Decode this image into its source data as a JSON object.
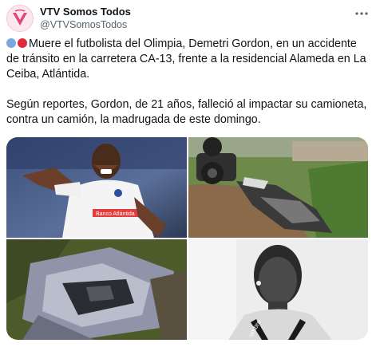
{
  "account": {
    "display_name": "VTV Somos Todos",
    "handle": "@VTVSomosTodos",
    "avatar_text": "V"
  },
  "tweet": {
    "paragraph1": "Muere el futbolista del Olimpia, Demetri Gordon, en un accidente de tránsito en la carretera CA-13, frente a la residencial Alameda en La Ceiba, Atlántida.",
    "paragraph2": "Según reportes, Gordon, de 21 años, falleció al impactar su camioneta, contra un camión, la madrugada de este domingo.",
    "emoji_colors": [
      "#7aa7e0",
      "#e0293b"
    ]
  },
  "media": {
    "count": 4,
    "shirt_text": "Banco Atlántida",
    "jacket_text": "umbro"
  },
  "colors": {
    "text": "#0f1419",
    "secondary": "#536471",
    "accent_pink": "#e0457b"
  }
}
